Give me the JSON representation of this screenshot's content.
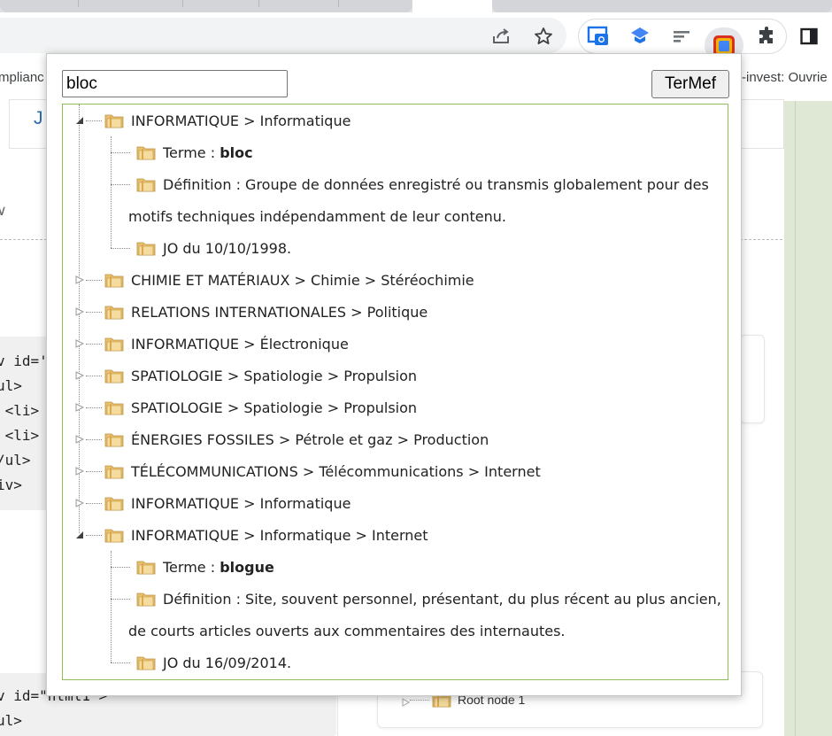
{
  "browser": {
    "bookmarks_left": "mplianc",
    "bookmarks_right": "-invest: Ouvrie"
  },
  "page": {
    "header_letter": "J",
    "code_block_1": [
      "v id='",
      "ul>",
      " <li>",
      " <li>",
      "/ul>",
      "iv>"
    ],
    "code_block_2": [
      "v id=\"html1\">",
      "ul>"
    ],
    "root_node_label": "Root node 1"
  },
  "popup": {
    "search_value": "bloc",
    "button_label": "TerMef",
    "results": [
      {
        "domain": "INFORMATIQUE > Informatique",
        "expanded": true,
        "term_label": "Terme : ",
        "term": "bloc",
        "definition_line1": "Définition : Groupe de données enregistré ou transmis globalement pour des",
        "definition_line2": "motifs techniques indépendamment de leur contenu.",
        "source": "JO du 10/10/1998."
      },
      {
        "domain": "CHIMIE ET MATÉRIAUX > Chimie > Stéréochimie",
        "expanded": false
      },
      {
        "domain": "RELATIONS INTERNATIONALES > Politique",
        "expanded": false
      },
      {
        "domain": "INFORMATIQUE > Électronique",
        "expanded": false
      },
      {
        "domain": "SPATIOLOGIE > Spatiologie > Propulsion",
        "expanded": false
      },
      {
        "domain": "SPATIOLOGIE > Spatiologie > Propulsion",
        "expanded": false
      },
      {
        "domain": "ÉNERGIES FOSSILES > Pétrole et gaz > Production",
        "expanded": false
      },
      {
        "domain": "TÉLÉCOMMUNICATIONS > Télécommunications > Internet",
        "expanded": false
      },
      {
        "domain": "INFORMATIQUE > Informatique",
        "expanded": false
      },
      {
        "domain": "INFORMATIQUE > Informatique > Internet",
        "expanded": true,
        "term_label": "Terme : ",
        "term": "blogue",
        "definition_line1": "Définition : Site, souvent personnel, présentant, du plus récent au plus ancien,",
        "definition_line2": "de courts articles ouverts aux commentaires des internautes.",
        "source": "JO du 16/09/2014."
      }
    ]
  },
  "colors": {
    "results_border": "#8fbf5a",
    "folder": "#e8c070",
    "right_strip": "#dfe7d5"
  },
  "icons": [
    "share-icon",
    "star-icon",
    "screenshot-extension-icon",
    "translate-extension-icon",
    "list-extension-icon",
    "termef-extension-icon",
    "puzzle-icon",
    "sidepanel-icon",
    "folder-icon",
    "expander-icon"
  ]
}
